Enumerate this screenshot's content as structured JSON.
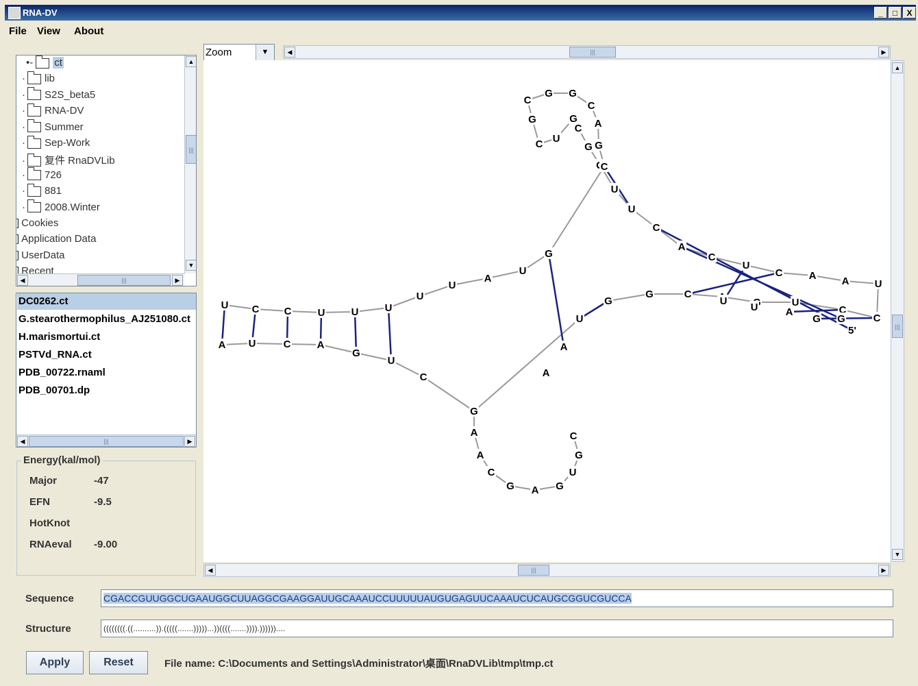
{
  "window": {
    "title": "RNA-DV",
    "minimize": "_",
    "maximize": "□",
    "close": "X"
  },
  "menu": [
    "File",
    "View",
    "About"
  ],
  "tree": {
    "items": [
      {
        "label": "ct",
        "level": 1,
        "selected": true
      },
      {
        "label": "lib",
        "level": 0
      },
      {
        "label": "S2S_beta5",
        "level": 0
      },
      {
        "label": "RNA-DV",
        "level": 0
      },
      {
        "label": "Summer",
        "level": 0
      },
      {
        "label": "Sep-Work",
        "level": 0
      },
      {
        "label": "复件 RnaDVLib",
        "level": 0
      },
      {
        "label": "726",
        "level": 0
      },
      {
        "label": "881",
        "level": 0
      },
      {
        "label": "2008.Winter",
        "level": 0
      },
      {
        "label": "Cookies",
        "level": -1
      },
      {
        "label": "Application Data",
        "level": -1
      },
      {
        "label": "UserData",
        "level": -1
      },
      {
        "label": "Recent",
        "level": -1
      }
    ]
  },
  "files": {
    "items": [
      "DC0262.ct",
      "G.stearothermophilus_AJ251080.ct",
      "H.marismortui.ct",
      "PSTVd_RNA.ct",
      "PDB_00722.rnaml",
      "PDB_00701.dp"
    ],
    "selected": 0
  },
  "energy": {
    "legend": "Energy(kal/mol)",
    "rows": [
      {
        "name": "Major",
        "value": "-47"
      },
      {
        "name": "EFN",
        "value": "-9.5"
      },
      {
        "name": "HotKnot",
        "value": ""
      },
      {
        "name": "RNAeval",
        "value": "-9.00"
      }
    ]
  },
  "zoom": {
    "label": "Zoom",
    "arrow": "▼"
  },
  "diagram": {
    "bases": [
      "U",
      "C",
      "C",
      "U",
      "U",
      "U",
      "U",
      "U",
      "A",
      "U",
      "G",
      "U",
      "U",
      "G",
      "A",
      "G",
      "U",
      "C",
      "C",
      "U",
      "A",
      "A",
      "C",
      "U",
      "C",
      "A",
      "C",
      "U",
      "U",
      "G",
      "G",
      "C",
      "G",
      "U",
      "C",
      "G",
      "C",
      "G",
      "G",
      "C",
      "A",
      "G",
      "C",
      "5'",
      "G",
      "G",
      "A",
      "U",
      "U",
      "C",
      "G",
      "G",
      "U",
      "A",
      "A",
      "G",
      "C",
      "U",
      "G",
      "A",
      "C",
      "U",
      "A",
      "G",
      "A",
      "A",
      "C",
      "G",
      "A",
      "G",
      "U",
      "G",
      "C"
    ],
    "primer": "5'",
    "pair_color": "#1a237e",
    "backbone_color": "#999999"
  },
  "sequence": {
    "label": "Sequence",
    "value": "CGACCGUUGGCUGAAUGGCUUAGGCGAAGGAUUGCAAAUCCUUUUUAUGUGAGUUCAAAUCUCAUGCGGUCGUCCA"
  },
  "structure": {
    "label": "Structure",
    "value": "((((((((.((..........)).(((((.......)))))...))((((.......)))).))))))...."
  },
  "buttons": {
    "apply": "Apply",
    "reset": "Reset"
  },
  "status": {
    "filename": "File name: C:\\Documents and Settings\\Administrator\\桌面\\RnaDVLib\\tmp\\tmp.ct"
  },
  "scroll": {
    "left": "◀",
    "right": "▶",
    "up": "▲",
    "down": "▼",
    "grip": "|||"
  }
}
